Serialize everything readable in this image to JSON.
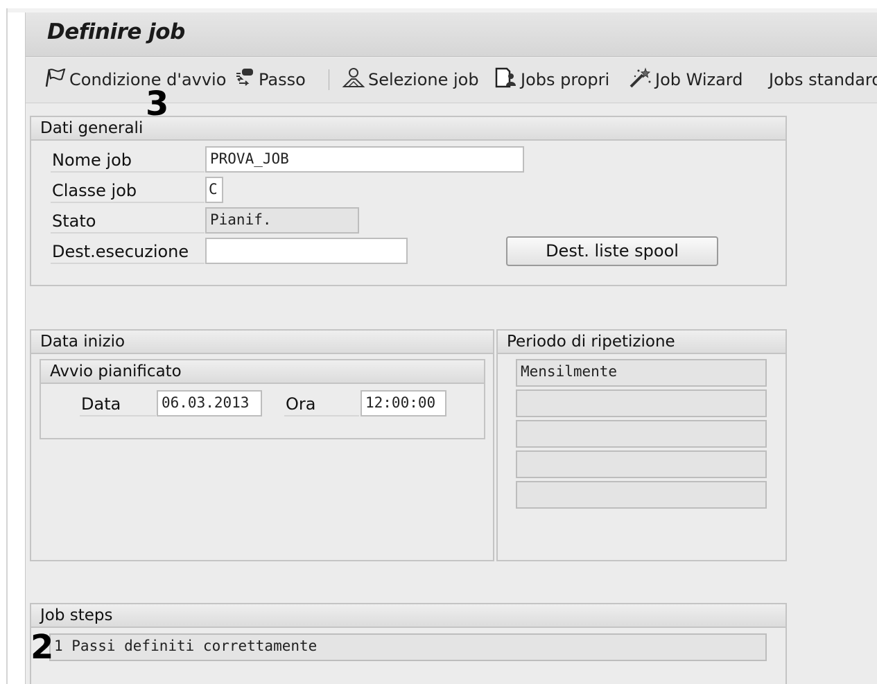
{
  "window": {
    "title": "Definire job"
  },
  "toolbar": {
    "items": [
      {
        "label": "Condizione d'avvio",
        "icon": "flag-icon"
      },
      {
        "label": "Passo",
        "icon": "step-icon"
      },
      {
        "label": "Selezione job",
        "icon": "person-icon"
      },
      {
        "label": "Jobs propri",
        "icon": "document-icon"
      },
      {
        "label": "Job Wizard",
        "icon": "wand-icon"
      },
      {
        "label": "Jobs standard"
      }
    ]
  },
  "dati_generali": {
    "header": "Dati generali",
    "nome_job": {
      "label": "Nome job",
      "value": "PROVA_JOB"
    },
    "classe_job": {
      "label": "Classe job",
      "value": "C"
    },
    "stato": {
      "label": "Stato",
      "value": "Pianif."
    },
    "dest_esecuzione": {
      "label": "Dest.esecuzione",
      "value": ""
    },
    "spool_button": "Dest. liste spool"
  },
  "data_inizio": {
    "header": "Data inizio",
    "subheader": "Avvio pianificato",
    "data": {
      "label": "Data",
      "value": "06.03.2013"
    },
    "ora": {
      "label": "Ora",
      "value": "12:00:00"
    }
  },
  "periodo": {
    "header": "Periodo di ripetizione",
    "values": [
      "Mensilmente",
      "",
      "",
      "",
      ""
    ]
  },
  "job_steps": {
    "header": "Job steps",
    "value": "1 Passi definiti correttamente"
  },
  "annotations": {
    "marker_3": "3",
    "marker_2": "2"
  }
}
